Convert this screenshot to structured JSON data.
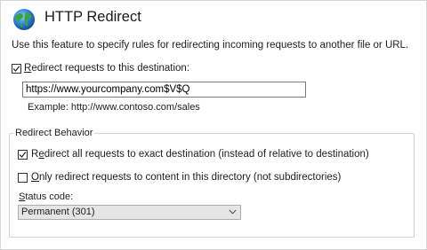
{
  "header": {
    "title": "HTTP Redirect",
    "icon": "globe-icon"
  },
  "description": "Use this feature to specify rules for redirecting incoming requests to another file or URL.",
  "redirect_toggle": {
    "checked": true,
    "label_underlined": "R",
    "label_rest": "edirect requests to this destination:"
  },
  "destination": {
    "value": "https://www.yourcompany.com$V$Q",
    "example": "Example: http://www.contoso.com/sales"
  },
  "redirect_behavior": {
    "legend": "Redirect Behavior",
    "exact_destination": {
      "checked": true,
      "label_before": "R",
      "label_underlined": "e",
      "label_rest": "direct all requests to exact destination (instead of relative to destination)"
    },
    "only_this_directory": {
      "checked": false,
      "label_underlined": "O",
      "label_rest": "nly redirect requests to content in this directory (not subdirectories)"
    },
    "status_code": {
      "label_underlined": "S",
      "label_rest": "tatus code:",
      "selected": "Permanent (301)"
    }
  },
  "colors": {
    "globe_blue": "#2a7fd4",
    "globe_green": "#3aa53a",
    "select_bg": "#e5e5e5"
  }
}
